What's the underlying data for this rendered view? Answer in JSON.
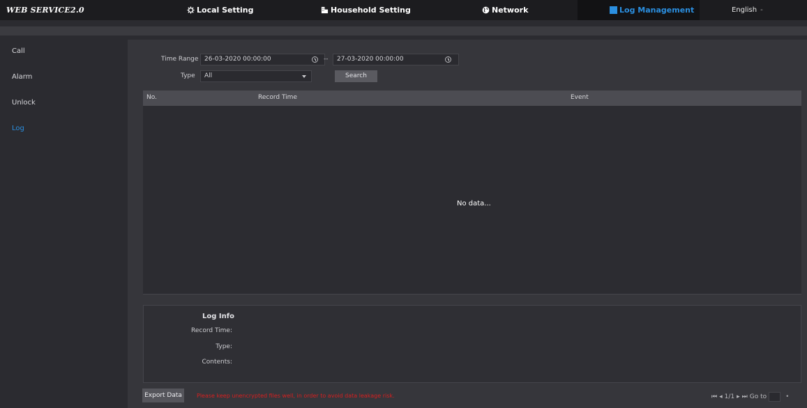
{
  "header": {
    "logo": "WEB SERVICE2.0",
    "nav": [
      {
        "label": "Local Setting",
        "icon": "gear-icon"
      },
      {
        "label": "Household Setting",
        "icon": "building-icon"
      },
      {
        "label": "Network",
        "icon": "globe-icon"
      },
      {
        "label": "Log Management",
        "icon": "log-icon",
        "active": true
      }
    ],
    "language": "English",
    "language_caret": "-"
  },
  "sidebar": {
    "items": [
      {
        "label": "Call"
      },
      {
        "label": "Alarm"
      },
      {
        "label": "Unlock"
      },
      {
        "label": "Log",
        "active": true
      }
    ]
  },
  "filters": {
    "time_range_label": "Time Range",
    "start": "26-03-2020 00:00:00",
    "separator": "--",
    "end": "27-03-2020 00:00:00",
    "type_label": "Type",
    "type_value": "All",
    "search_label": "Search"
  },
  "table": {
    "columns": [
      "No.",
      "Record Time",
      "Event"
    ],
    "empty_text": "No data..."
  },
  "log_info": {
    "title": "Log Info",
    "record_time_label": "Record Time:",
    "type_label": "Type:",
    "contents_label": "Contents:"
  },
  "footer": {
    "export_label": "Export Data",
    "warning": "Please keep unencrypted files well, in order to avoid data leakage risk.",
    "pager_first": "⏮",
    "pager_prev": "◂",
    "page": "1/1",
    "pager_next": "▸",
    "pager_last": "⏭",
    "goto_label": "Go to",
    "goto_btn": "•"
  },
  "colors": {
    "accent": "#2b8fe0",
    "warning": "#d62020",
    "background": "#2b2b30",
    "header": "#1c1c1f"
  }
}
